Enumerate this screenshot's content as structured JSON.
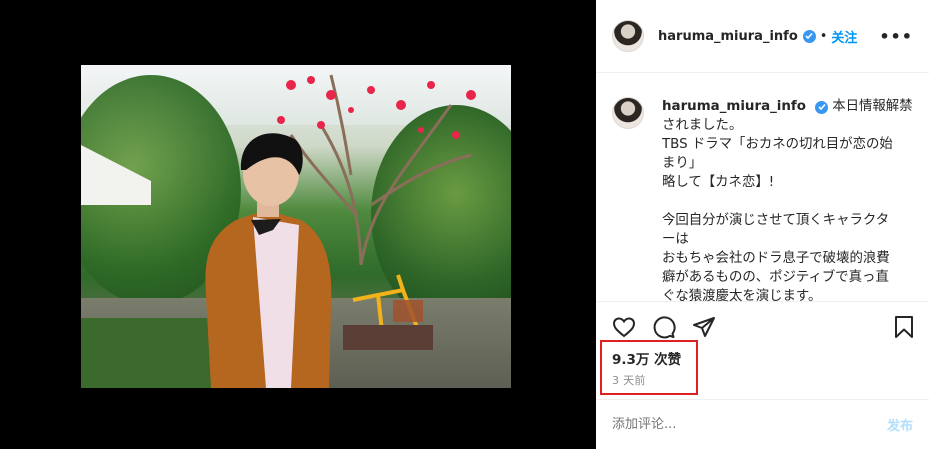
{
  "post": {
    "username": "haruma_miura_info",
    "follow_label": "关注",
    "more_label": "•••",
    "dot": "•"
  },
  "caption": {
    "username": "haruma_miura_info",
    "lines": [
      "本日情報解禁",
      "されました。",
      "TBS ドラマ「おカネの切れ目が恋の始",
      "まり」",
      "略して【カネ恋】!",
      "",
      "今回自分が演じさせて頂くキャラクタ",
      "ーは",
      "おもちゃ会社のドラ息子で破壊的浪費",
      "癖があるものの、ポジティブで真っ直",
      "ぐな猿渡慶太を演じます。"
    ]
  },
  "stats": {
    "likes": "9.3万 次赞",
    "time": "3 天前"
  },
  "comment": {
    "placeholder": "添加评论...",
    "post_label": "发布"
  },
  "icons": [
    "heart-icon",
    "comment-icon",
    "share-icon",
    "save-icon",
    "verified-icon",
    "more-icon"
  ],
  "colors": {
    "accent": "#0095f6",
    "verified": "#3897f0",
    "highlight": "#e02020"
  }
}
